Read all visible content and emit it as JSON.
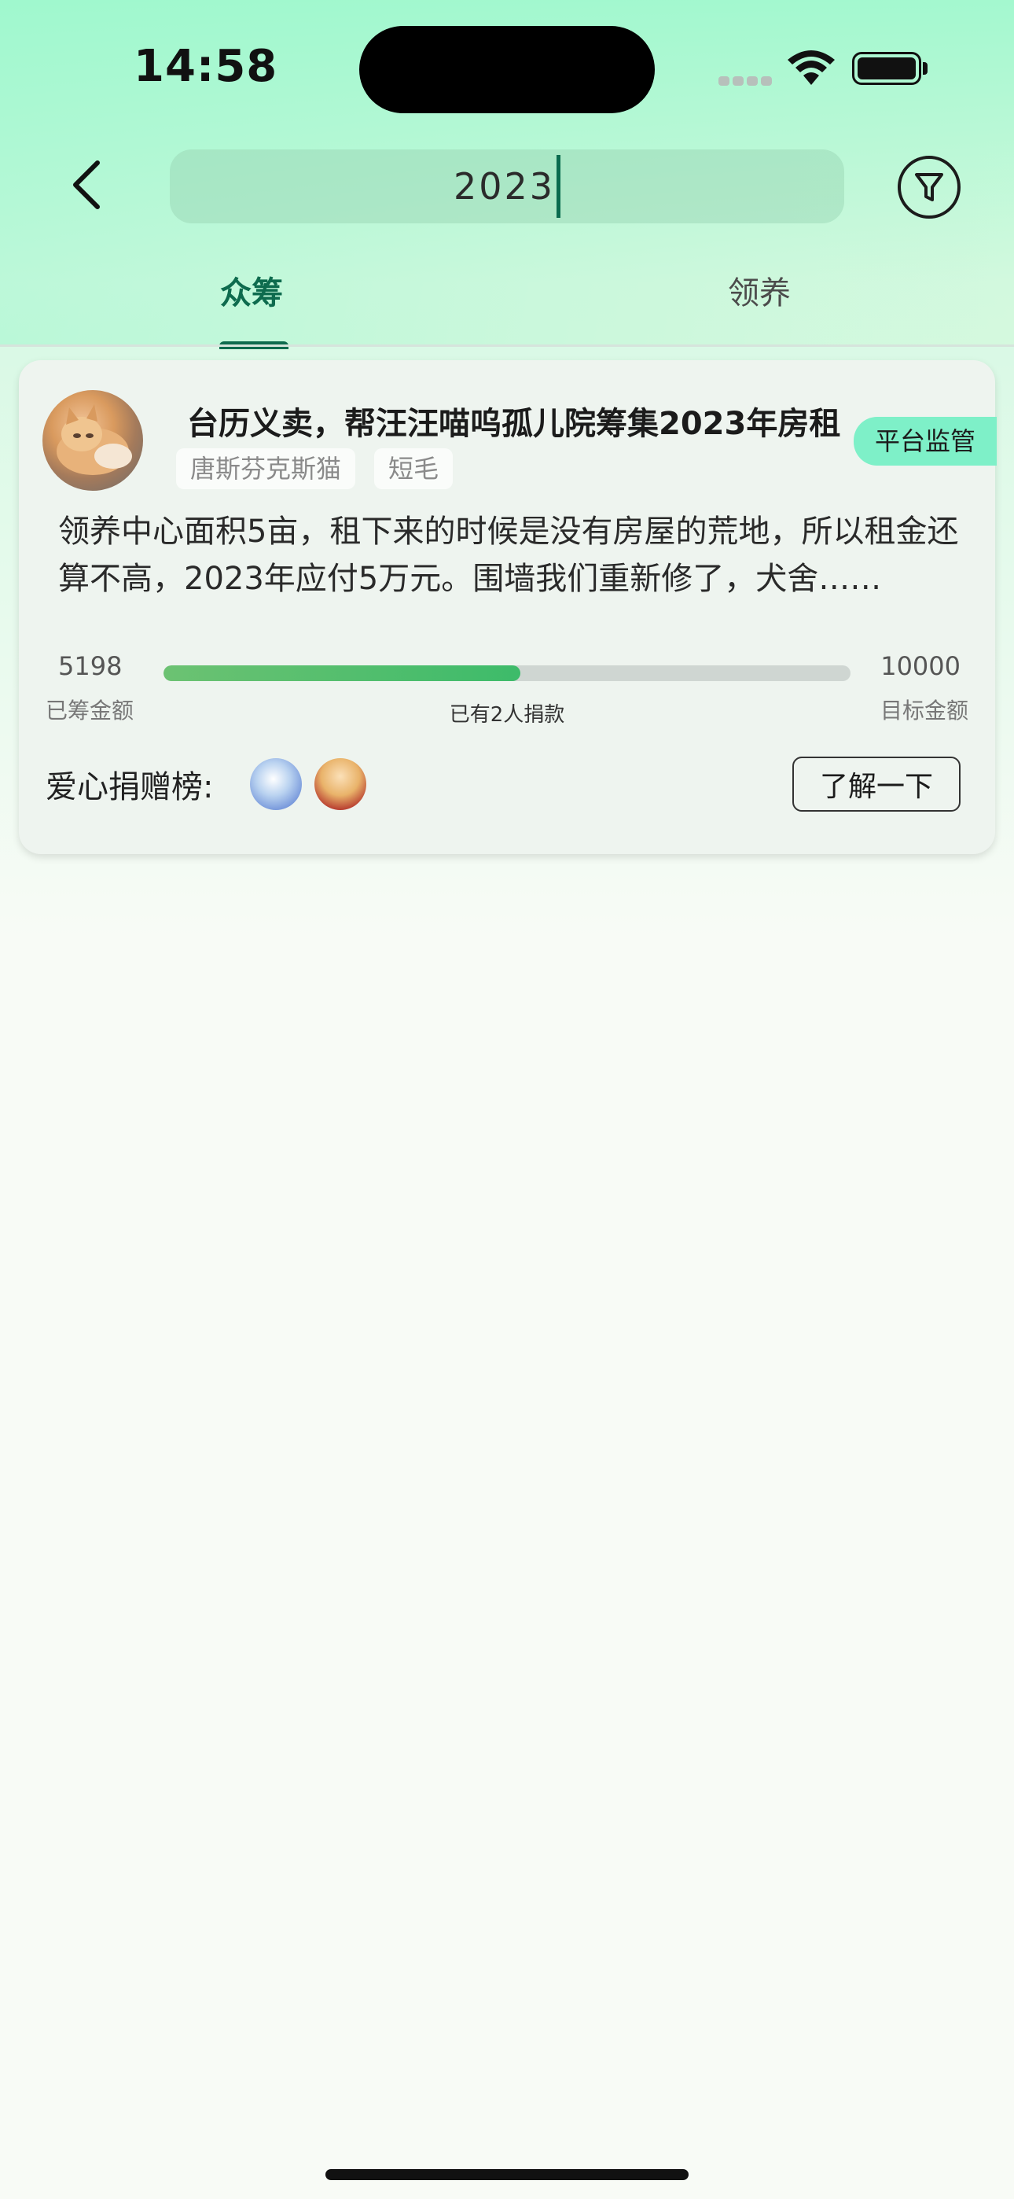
{
  "status_bar": {
    "time": "14:58"
  },
  "header": {
    "search_value": "2023",
    "icons": {
      "back": "chevron-left-icon",
      "filter": "filter-icon"
    }
  },
  "tabs": [
    {
      "label": "众筹",
      "active": true
    },
    {
      "label": "领养",
      "active": false
    }
  ],
  "colors": {
    "accent": "#0e6b4e",
    "badge": "#7ef0c8",
    "progress": "#3dbb6a"
  },
  "card": {
    "title": "台历义卖，帮汪汪喵呜孤儿院筹集2023年房租",
    "tags": [
      "唐斯芬克斯猫",
      "短毛"
    ],
    "badge": "平台监管",
    "description": "领养中心面积5亩，租下来的时候是没有房屋的荒地，所以租金还算不高，2023年应付5万元。围墙我们重新修了，犬舍……",
    "raised_amount": "5198",
    "raised_label": "已筹金额",
    "target_amount": "10000",
    "target_label": "目标金额",
    "progress_fraction": 0.52,
    "donors_text": "已有2人捐款",
    "donation_board_label": "爱心捐赠榜:",
    "learn_more_label": "了解一下"
  }
}
